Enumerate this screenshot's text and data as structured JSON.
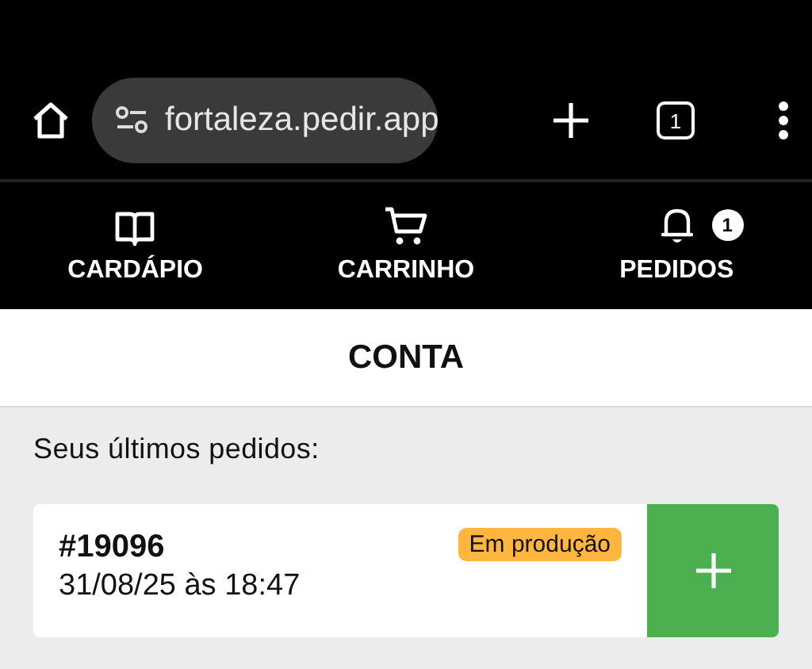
{
  "browser": {
    "url": "fortaleza.pedir.app",
    "tab_count": "1"
  },
  "nav": [
    {
      "label": "CARDÁPIO"
    },
    {
      "label": "CARRINHO"
    },
    {
      "label": "PEDIDOS",
      "badge": "1"
    }
  ],
  "header": {
    "title": "CONTA"
  },
  "orders_heading": "Seus últimos pedidos:",
  "orders": [
    {
      "number": "#19096",
      "datetime": "31/08/25 às 18:47",
      "status": "Em produção"
    }
  ]
}
